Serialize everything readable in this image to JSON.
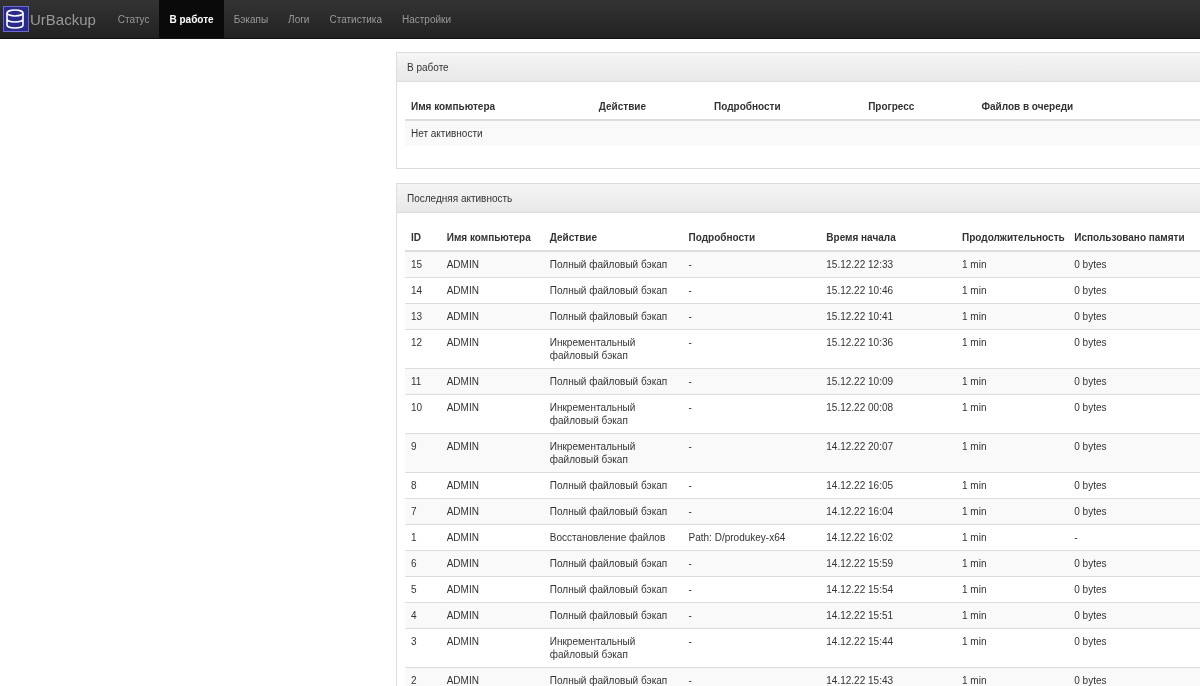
{
  "navbar": {
    "brand": "UrBackup",
    "items": [
      {
        "label": "Статус",
        "selected": false
      },
      {
        "label": "В работе",
        "selected": true
      },
      {
        "label": "Бэкапы",
        "selected": false
      },
      {
        "label": "Логи",
        "selected": false
      },
      {
        "label": "Статистика",
        "selected": false
      },
      {
        "label": "Настройки",
        "selected": false
      }
    ]
  },
  "in_progress": {
    "title": "В работе",
    "columns": [
      "Имя компьютера",
      "Действие",
      "Подробности",
      "Прогресс",
      "Файлов в очереди"
    ],
    "empty_message": "Нет активности"
  },
  "recent_activity": {
    "title": "Последняя активность",
    "columns": [
      "ID",
      "Имя компьютера",
      "Действие",
      "Подробности",
      "Время начала",
      "Продолжительность",
      "Использовано памяти"
    ],
    "rows": [
      [
        "15",
        "ADMIN",
        "Полный файловый бэкап",
        "-",
        "15.12.22 12:33",
        "1 min",
        "0 bytes"
      ],
      [
        "14",
        "ADMIN",
        "Полный файловый бэкап",
        "-",
        "15.12.22 10:46",
        "1 min",
        "0 bytes"
      ],
      [
        "13",
        "ADMIN",
        "Полный файловый бэкап",
        "-",
        "15.12.22 10:41",
        "1 min",
        "0 bytes"
      ],
      [
        "12",
        "ADMIN",
        "Инкрементальный файловый бэкап",
        "-",
        "15.12.22 10:36",
        "1 min",
        "0 bytes"
      ],
      [
        "11",
        "ADMIN",
        "Полный файловый бэкап",
        "-",
        "15.12.22 10:09",
        "1 min",
        "0 bytes"
      ],
      [
        "10",
        "ADMIN",
        "Инкрементальный файловый бэкап",
        "-",
        "15.12.22 00:08",
        "1 min",
        "0 bytes"
      ],
      [
        "9",
        "ADMIN",
        "Инкрементальный файловый бэкап",
        "-",
        "14.12.22 20:07",
        "1 min",
        "0 bytes"
      ],
      [
        "8",
        "ADMIN",
        "Полный файловый бэкап",
        "-",
        "14.12.22 16:05",
        "1 min",
        "0 bytes"
      ],
      [
        "7",
        "ADMIN",
        "Полный файловый бэкап",
        "-",
        "14.12.22 16:04",
        "1 min",
        "0 bytes"
      ],
      [
        "1",
        "ADMIN",
        "Восстановление файлов",
        "Path: D/produkey-x64",
        "14.12.22 16:02",
        "1 min",
        "-"
      ],
      [
        "6",
        "ADMIN",
        "Полный файловый бэкап",
        "-",
        "14.12.22 15:59",
        "1 min",
        "0 bytes"
      ],
      [
        "5",
        "ADMIN",
        "Полный файловый бэкап",
        "-",
        "14.12.22 15:54",
        "1 min",
        "0 bytes"
      ],
      [
        "4",
        "ADMIN",
        "Полный файловый бэкап",
        "-",
        "14.12.22 15:51",
        "1 min",
        "0 bytes"
      ],
      [
        "3",
        "ADMIN",
        "Инкрементальный файловый бэкап",
        "-",
        "14.12.22 15:44",
        "1 min",
        "0 bytes"
      ],
      [
        "2",
        "ADMIN",
        "Полный файловый бэкап",
        "-",
        "14.12.22 15:43",
        "1 min",
        "0 bytes"
      ]
    ]
  }
}
